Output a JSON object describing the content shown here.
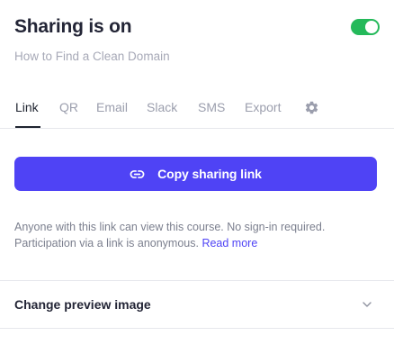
{
  "header": {
    "title": "Sharing is on",
    "subtitle": "How to Find a Clean Domain",
    "sharing_enabled": true
  },
  "tabs": [
    {
      "label": "Link",
      "active": true
    },
    {
      "label": "QR",
      "active": false
    },
    {
      "label": "Email",
      "active": false
    },
    {
      "label": "Slack",
      "active": false
    },
    {
      "label": "SMS",
      "active": false
    },
    {
      "label": "Export",
      "active": false
    }
  ],
  "settings_icon": "gear-icon",
  "copy_button": {
    "label": "Copy sharing link",
    "icon": "link-icon"
  },
  "info": {
    "line1": "Anyone with this link can view this course. No sign-in required.",
    "line2": "Participation via a link is anonymous.",
    "link_label": "Read more"
  },
  "accordion": {
    "label": "Change preview image",
    "icon": "chevron-down-icon",
    "expanded": false
  },
  "colors": {
    "accent": "#4f43f5",
    "toggle_on": "#24b95a",
    "muted_text": "#9b9ead",
    "divider": "#e6e7ec"
  }
}
